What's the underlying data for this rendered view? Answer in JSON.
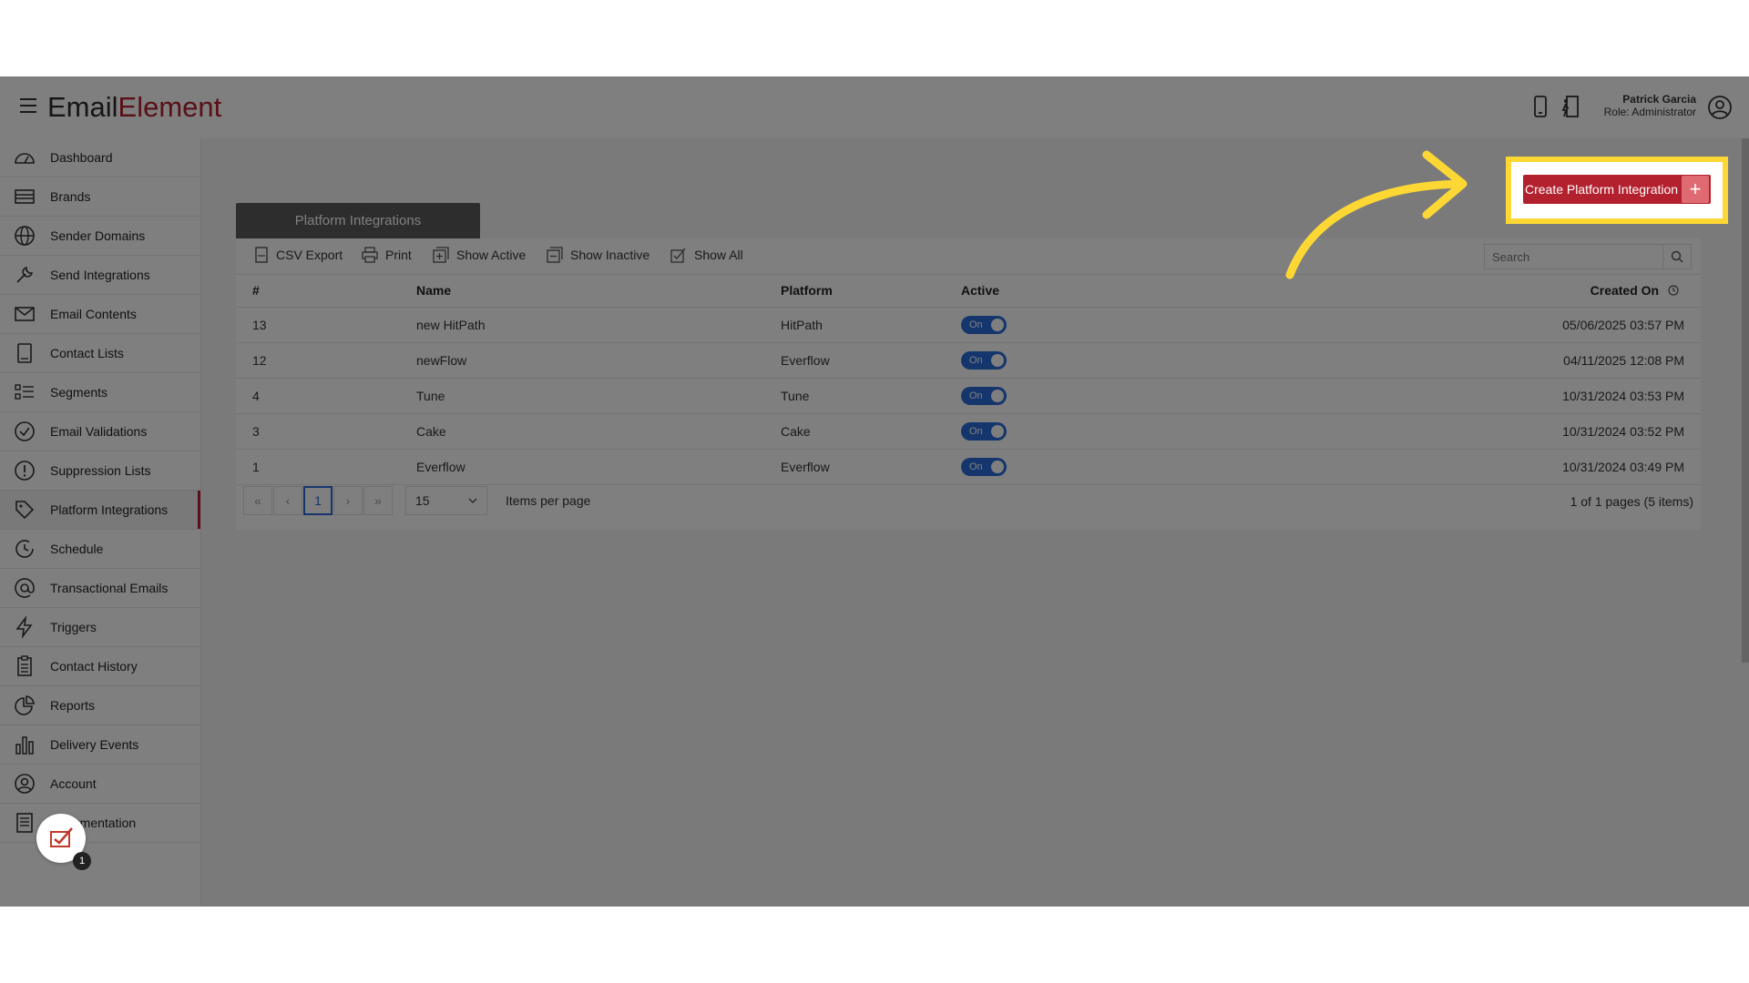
{
  "app": {
    "logo_part1": "Em",
    "logo_part2": "ail",
    "logo_part3": "Element",
    "user_name": "Patrick Garcia",
    "user_role": "Role: Administrator"
  },
  "sidebar": {
    "items": [
      {
        "label": "Dashboard",
        "icon": "dashboard-icon"
      },
      {
        "label": "Brands",
        "icon": "brands-icon"
      },
      {
        "label": "Sender Domains",
        "icon": "globe-icon"
      },
      {
        "label": "Send Integrations",
        "icon": "wrench-icon"
      },
      {
        "label": "Email Contents",
        "icon": "envelope-icon"
      },
      {
        "label": "Contact Lists",
        "icon": "list-icon"
      },
      {
        "label": "Segments",
        "icon": "segments-icon"
      },
      {
        "label": "Email Validations",
        "icon": "check-circle-icon"
      },
      {
        "label": "Suppression Lists",
        "icon": "alert-circle-icon"
      },
      {
        "label": "Platform Integrations",
        "icon": "tag-icon",
        "active": true
      },
      {
        "label": "Schedule",
        "icon": "clock-icon"
      },
      {
        "label": "Transactional Emails",
        "icon": "at-icon"
      },
      {
        "label": "Triggers",
        "icon": "bolt-icon"
      },
      {
        "label": "Contact History",
        "icon": "clipboard-icon"
      },
      {
        "label": "Reports",
        "icon": "pie-chart-icon"
      },
      {
        "label": "Delivery Events",
        "icon": "bar-chart-icon"
      },
      {
        "label": "Account",
        "icon": "user-circle-icon"
      },
      {
        "label": "Documentation",
        "icon": "document-icon"
      }
    ],
    "feedback_badge": "1"
  },
  "main": {
    "tab_label": "Platform Integrations",
    "create_button_label": "Create Platform Integration",
    "toolbar": {
      "csv_export": "CSV Export",
      "print": "Print",
      "show_active": "Show Active",
      "show_inactive": "Show Inactive",
      "show_all": "Show All",
      "search_placeholder": "Search"
    },
    "columns": {
      "num": "#",
      "name": "Name",
      "platform": "Platform",
      "active": "Active",
      "created_on": "Created On"
    },
    "rows": [
      {
        "num": "13",
        "name": "new HitPath",
        "platform": "HitPath",
        "active": "On",
        "created": "05/06/2025 03:57 PM"
      },
      {
        "num": "12",
        "name": "newFlow",
        "platform": "Everflow",
        "active": "On",
        "created": "04/11/2025 12:08 PM"
      },
      {
        "num": "4",
        "name": "Tune",
        "platform": "Tune",
        "active": "On",
        "created": "10/31/2024 03:53 PM"
      },
      {
        "num": "3",
        "name": "Cake",
        "platform": "Cake",
        "active": "On",
        "created": "10/31/2024 03:52 PM"
      },
      {
        "num": "1",
        "name": "Everflow",
        "platform": "Everflow",
        "active": "On",
        "created": "10/31/2024 03:49 PM"
      }
    ],
    "pager": {
      "first": "«",
      "prev": "‹",
      "current_page": "1",
      "next": "›",
      "last": "»",
      "page_size": "15",
      "items_per_page": "Items per page",
      "info": "1 of 1 pages (5 items)"
    }
  },
  "colors": {
    "brand": "#b3202e",
    "accent": "#2a6dd8",
    "highlight": "#fdd835"
  }
}
